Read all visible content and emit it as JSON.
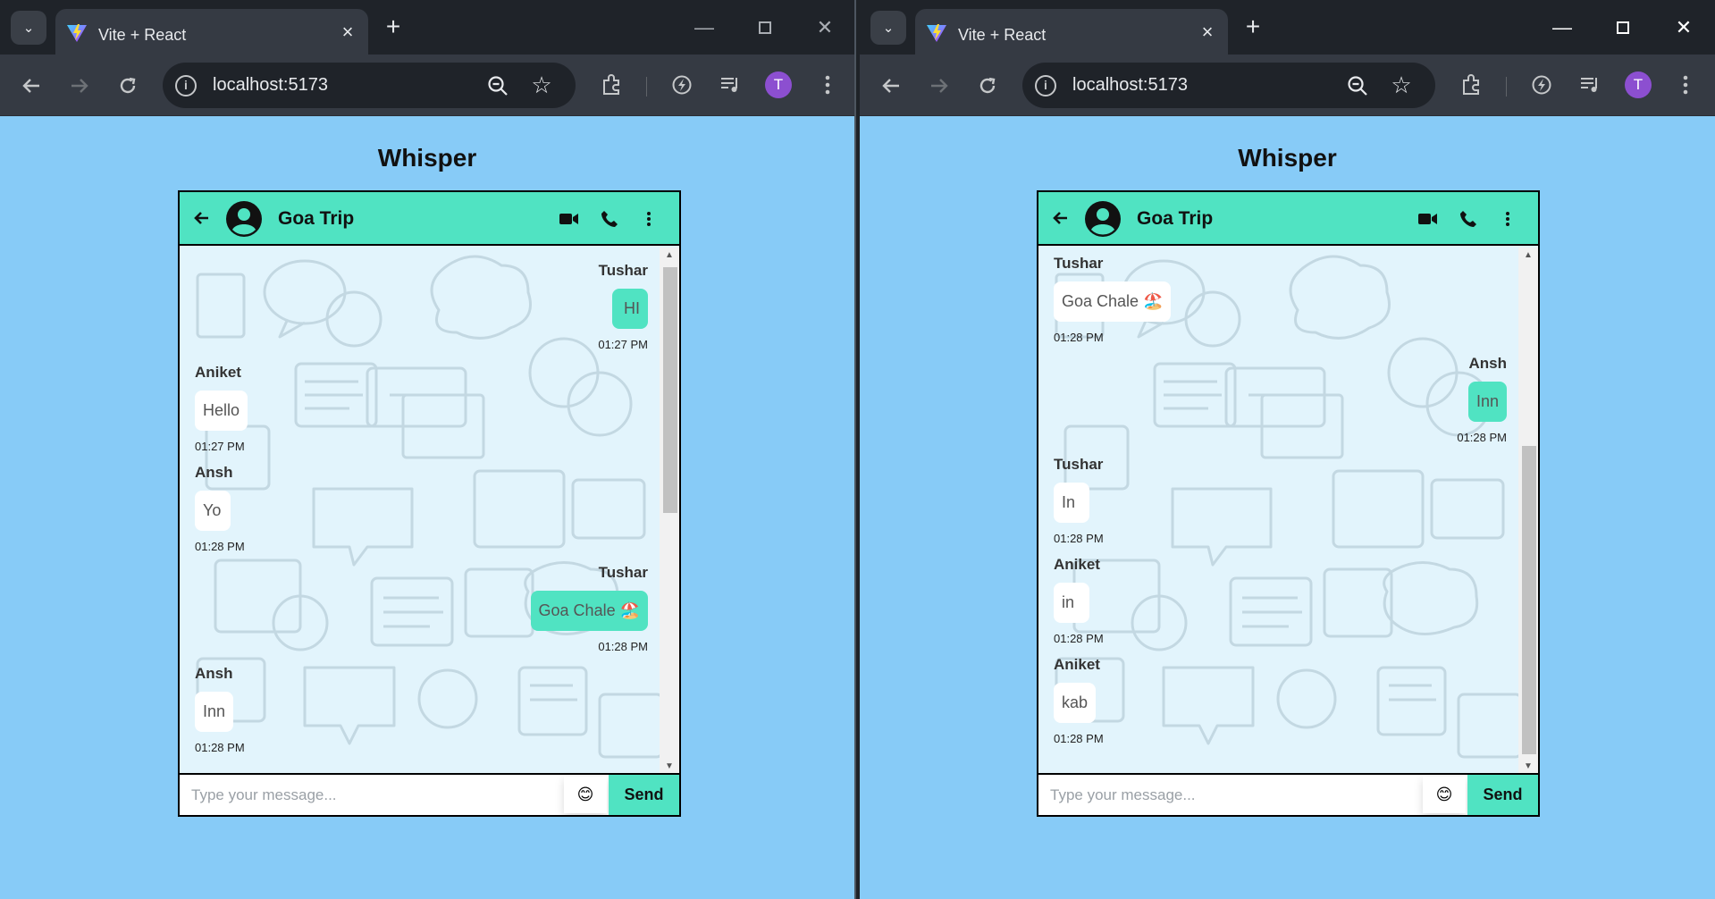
{
  "browser": {
    "tab_title": "Vite + React",
    "url": "localhost:5173",
    "profile_initial": "T"
  },
  "app": {
    "title": "Whisper",
    "group_name": "Goa Trip",
    "input_placeholder": "Type your message...",
    "emoji": "😊",
    "send_label": "Send"
  },
  "colors": {
    "page_background": "#87cbf7",
    "accent": "#50e3c2",
    "chat_background": "#e2f4fc"
  },
  "windows": [
    {
      "scroll_fraction": 0.0,
      "messages": [
        {
          "sender": "Tushar",
          "text": "HI",
          "time": "01:27 PM",
          "direction": "sent"
        },
        {
          "sender": "Aniket",
          "text": "Hello",
          "time": "01:27 PM",
          "direction": "received"
        },
        {
          "sender": "Ansh",
          "text": "Yo",
          "time": "01:28 PM",
          "direction": "received"
        },
        {
          "sender": "Tushar",
          "text": "Goa Chale 🏖️",
          "time": "01:28 PM",
          "direction": "sent"
        },
        {
          "sender": "Ansh",
          "text": "Inn",
          "time": "01:28 PM",
          "direction": "received"
        }
      ]
    },
    {
      "scroll_fraction": 1.0,
      "messages": [
        {
          "sender": "Tushar",
          "text": "Goa Chale 🏖️",
          "time": "01:28 PM",
          "direction": "received"
        },
        {
          "sender": "Ansh",
          "text": "Inn",
          "time": "01:28 PM",
          "direction": "sent"
        },
        {
          "sender": "Tushar",
          "text": "In",
          "time": "01:28 PM",
          "direction": "received"
        },
        {
          "sender": "Aniket",
          "text": "in",
          "time": "01:28 PM",
          "direction": "received"
        },
        {
          "sender": "Aniket",
          "text": "kab",
          "time": "01:28 PM",
          "direction": "received"
        }
      ]
    }
  ]
}
